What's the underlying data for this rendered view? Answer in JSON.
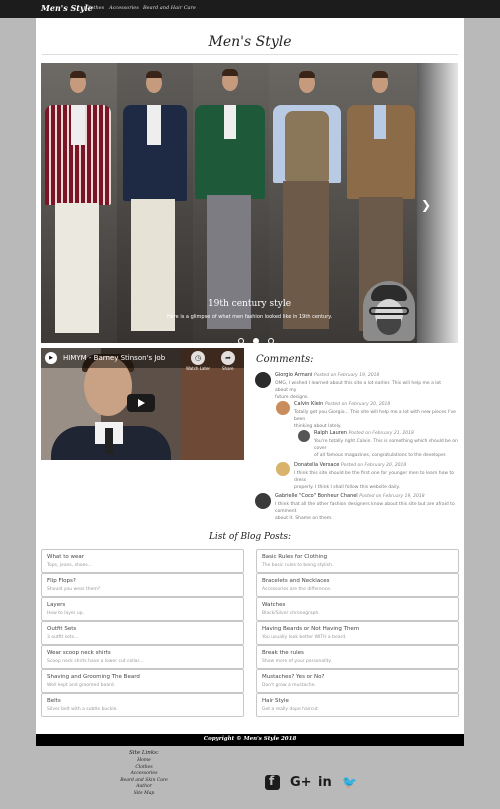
{
  "navbar": {
    "brand": "Men's Style",
    "links": [
      "Clothes",
      "Accessories",
      "Beard and Hair Care"
    ]
  },
  "header": {
    "title": "Men's Style"
  },
  "carousel": {
    "caption_title": "19th century style",
    "caption_text": "Here is a glimpse of what men fashion looked like in 19th century.",
    "next_icon": "chevron-right-icon",
    "slide_count": 3,
    "active_slide": 2
  },
  "video": {
    "channel_icon": "youtube-channel-icon",
    "title": "HIMYM - Barney Stinson's Job",
    "watch_later_label": "Watch Later",
    "share_label": "Share",
    "play_icon": "play-icon"
  },
  "comments": {
    "title": "Comments:",
    "items": [
      {
        "author": "Giorgio Armani",
        "date": "Posted on February 19, 2018",
        "text_lines": [
          "OMG, I wished I learned about this site a lot earlier. This will help me a lot about my",
          "future designs."
        ]
      },
      {
        "author": "Calvin Klein",
        "date": "Posted on February 20, 2018",
        "text_lines": [
          "Totally get you Giorgio... This site will help me a lot with new pieces I've been",
          "thinking about lately."
        ]
      },
      {
        "author": "Ralph Lauren",
        "date": "Posted on February 21, 2018",
        "text_lines": [
          "You're totally right Calvin. This is something which should be on cover",
          "of all famous magazines, congratulations to the developer."
        ]
      },
      {
        "author": "Donatella Versace",
        "date": "Posted on February 20, 2018",
        "text_lines": [
          "I think this site should be the first one for younger men to learn how to dress",
          "properly. I think I shall follow this website daily."
        ]
      },
      {
        "author": "Gabrielle \"Coco\" Bonheur Chanel",
        "date": "Posted on February 19, 2018",
        "text_lines": [
          "I think that all the other fashion designers know about this site but are afraid to comment",
          "about it. Shame on them."
        ]
      }
    ]
  },
  "blog": {
    "title": "List of Blog Posts:",
    "left": [
      {
        "title": "What to wear",
        "subtitle": "Tops, jeans, shoes..."
      },
      {
        "title": "Flip Flops?",
        "subtitle": "Should you wear them?"
      },
      {
        "title": "Layers",
        "subtitle": "How to layer up."
      },
      {
        "title": "Outfit Sets",
        "subtitle": "3 outfit sets..."
      },
      {
        "title": "Wear scoop neck shirts",
        "subtitle": "Scoop neck shirts have a lower cut collar..."
      },
      {
        "title": "Shaving and Grooming The Beard",
        "subtitle": "Well kept and groomed beard."
      },
      {
        "title": "Belts",
        "subtitle": "Silver belt with a subtle buckle."
      }
    ],
    "right": [
      {
        "title": "Basic Rules for Clothing",
        "subtitle": "The basic rules to being stylish."
      },
      {
        "title": "Bracelets and Necklaces",
        "subtitle": "Accessories are the difference."
      },
      {
        "title": "Watches",
        "subtitle": "Black/Silver chronograph."
      },
      {
        "title": "Having Beards or Not Having Them",
        "subtitle": "You usually look better WITH a beard."
      },
      {
        "title": "Break the rules",
        "subtitle": "Show more of your personality."
      },
      {
        "title": "Mustaches? Yes or No?",
        "subtitle": "Don't grow a mustache."
      },
      {
        "title": "Hair Style",
        "subtitle": "Get a really dope haircut."
      }
    ]
  },
  "footer": {
    "copyright": "Copyright © Men's Style 2018",
    "site_links_title": "Site Links:",
    "site_links": [
      "Home",
      "Clothes",
      "Accessories",
      "Beard and Skin Care",
      "Author",
      "Site Map"
    ],
    "social_icons": [
      "facebook-icon",
      "google-plus-icon",
      "linkedin-icon",
      "twitter-icon"
    ],
    "social_glyphs": [
      "f",
      "G+",
      "in",
      "🐦"
    ]
  },
  "colors": {
    "navbar_bg": "#1c1c1c",
    "page_bg": "#b9b9b9",
    "footer_bg": "#000000"
  }
}
